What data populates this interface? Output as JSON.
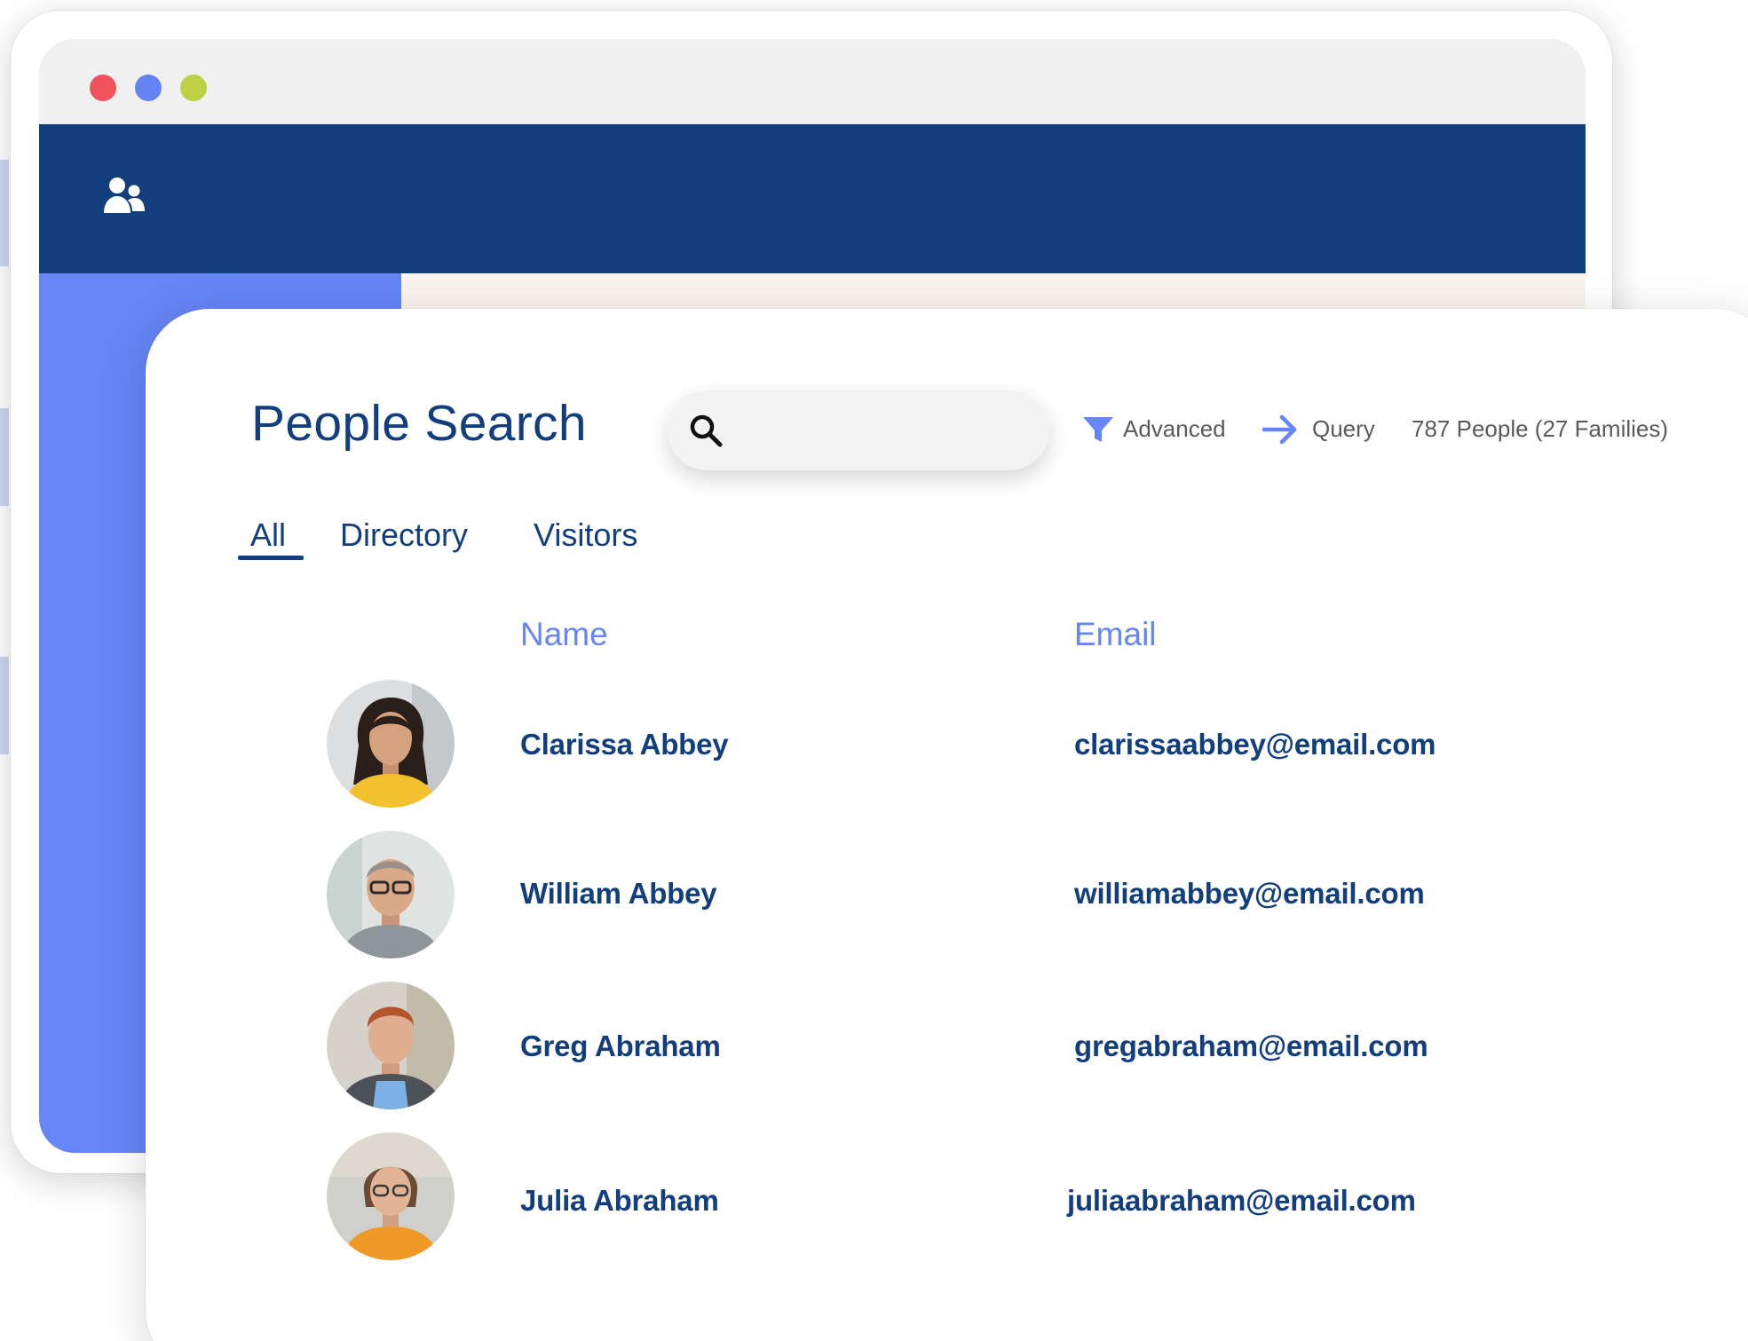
{
  "page": {
    "title": "People Search"
  },
  "search": {
    "placeholder": "",
    "value": ""
  },
  "toolbar": {
    "advanced_label": "Advanced",
    "query_label": "Query",
    "count_label": "787 People (27 Families)"
  },
  "tabs": [
    {
      "label": "All",
      "active": true
    },
    {
      "label": "Directory",
      "active": false
    },
    {
      "label": "Visitors",
      "active": false
    }
  ],
  "table": {
    "columns": [
      "Name",
      "Email"
    ],
    "rows": [
      {
        "name": "Clarissa Abbey",
        "email": "clarissaabbey@email.com"
      },
      {
        "name": "William Abbey",
        "email": "williamabbey@email.com"
      },
      {
        "name": "Greg Abraham",
        "email": "gregabraham@email.com"
      },
      {
        "name": "Julia Abraham",
        "email": "juliaabraham@email.com"
      }
    ]
  },
  "icons": {
    "window_dots": [
      "close-dot",
      "minimize-dot",
      "maximize-dot"
    ],
    "nav": "people-icon",
    "search": "search-icon",
    "advanced": "filter-icon",
    "query": "arrow-right-icon"
  },
  "colors": {
    "navy": "#123e7e",
    "accent_blue": "#6685f6",
    "dot_red": "#f0515a",
    "dot_blue": "#6683f5",
    "dot_green": "#bcd244",
    "content_bg": "#faf4ee"
  }
}
